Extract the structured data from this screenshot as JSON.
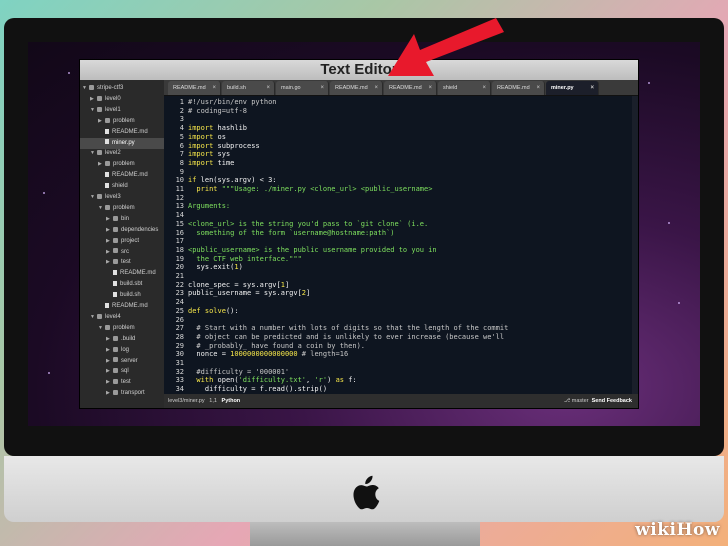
{
  "window_title": "Text Editor",
  "sidebar": [
    {
      "label": "stripe-ctf3",
      "depth": 0,
      "type": "folder",
      "open": true
    },
    {
      "label": "level0",
      "depth": 1,
      "type": "folder",
      "open": false
    },
    {
      "label": "level1",
      "depth": 1,
      "type": "folder",
      "open": true
    },
    {
      "label": "problem",
      "depth": 2,
      "type": "folder",
      "open": false
    },
    {
      "label": "README.md",
      "depth": 2,
      "type": "file"
    },
    {
      "label": "miner.py",
      "depth": 2,
      "type": "file",
      "selected": true
    },
    {
      "label": "level2",
      "depth": 1,
      "type": "folder",
      "open": true
    },
    {
      "label": "problem",
      "depth": 2,
      "type": "folder",
      "open": false
    },
    {
      "label": "README.md",
      "depth": 2,
      "type": "file"
    },
    {
      "label": "shield",
      "depth": 2,
      "type": "file"
    },
    {
      "label": "level3",
      "depth": 1,
      "type": "folder",
      "open": true
    },
    {
      "label": "problem",
      "depth": 2,
      "type": "folder",
      "open": true
    },
    {
      "label": "bin",
      "depth": 3,
      "type": "folder",
      "open": false
    },
    {
      "label": "dependencies",
      "depth": 3,
      "type": "folder",
      "open": false
    },
    {
      "label": "project",
      "depth": 3,
      "type": "folder",
      "open": false
    },
    {
      "label": "src",
      "depth": 3,
      "type": "folder",
      "open": false
    },
    {
      "label": "test",
      "depth": 3,
      "type": "folder",
      "open": false
    },
    {
      "label": "README.md",
      "depth": 3,
      "type": "file"
    },
    {
      "label": "build.sbt",
      "depth": 3,
      "type": "file"
    },
    {
      "label": "build.sh",
      "depth": 3,
      "type": "file"
    },
    {
      "label": "README.md",
      "depth": 2,
      "type": "file"
    },
    {
      "label": "level4",
      "depth": 1,
      "type": "folder",
      "open": true
    },
    {
      "label": "problem",
      "depth": 2,
      "type": "folder",
      "open": true
    },
    {
      "label": ".build",
      "depth": 3,
      "type": "folder",
      "open": false
    },
    {
      "label": "log",
      "depth": 3,
      "type": "folder",
      "open": false
    },
    {
      "label": "server",
      "depth": 3,
      "type": "folder",
      "open": false
    },
    {
      "label": "sql",
      "depth": 3,
      "type": "folder",
      "open": false
    },
    {
      "label": "test",
      "depth": 3,
      "type": "folder",
      "open": false
    },
    {
      "label": "transport",
      "depth": 3,
      "type": "folder",
      "open": false
    }
  ],
  "tabs": [
    {
      "label": "README.md",
      "active": false
    },
    {
      "label": "build.sh",
      "active": false
    },
    {
      "label": "main.go",
      "active": false
    },
    {
      "label": "README.md",
      "active": false
    },
    {
      "label": "README.md",
      "active": false
    },
    {
      "label": "shield",
      "active": false
    },
    {
      "label": "README.md",
      "active": false
    },
    {
      "label": "miner.py",
      "active": true
    }
  ],
  "code": [
    {
      "n": "1",
      "s": [
        [
          "#!/usr/bin/env python",
          "comment"
        ]
      ]
    },
    {
      "n": "2",
      "s": [
        [
          "# coding=utf-8",
          "comment"
        ]
      ]
    },
    {
      "n": "3",
      "s": []
    },
    {
      "n": "4",
      "s": [
        [
          "import",
          "keyword"
        ],
        [
          " hashlib",
          "normal"
        ]
      ]
    },
    {
      "n": "5",
      "s": [
        [
          "import",
          "keyword"
        ],
        [
          " os",
          "normal"
        ]
      ]
    },
    {
      "n": "6",
      "s": [
        [
          "import",
          "keyword"
        ],
        [
          " subprocess",
          "normal"
        ]
      ]
    },
    {
      "n": "7",
      "s": [
        [
          "import",
          "keyword"
        ],
        [
          " sys",
          "normal"
        ]
      ]
    },
    {
      "n": "8",
      "s": [
        [
          "import",
          "keyword"
        ],
        [
          " time",
          "normal"
        ]
      ]
    },
    {
      "n": "9",
      "s": []
    },
    {
      "n": "10",
      "s": [
        [
          "if",
          "keyword"
        ],
        [
          " len(sys.argv) < 3:",
          "normal"
        ]
      ]
    },
    {
      "n": "11",
      "s": [
        [
          "  print ",
          "keyword"
        ],
        [
          "\"\"\"Usage: ./miner.py <clone_url> <public_username>",
          "string"
        ]
      ]
    },
    {
      "n": "12",
      "s": []
    },
    {
      "n": "13",
      "s": [
        [
          "Arguments:",
          "string"
        ]
      ]
    },
    {
      "n": "14",
      "s": []
    },
    {
      "n": "15",
      "s": [
        [
          "<clone_url> is the string you'd pass to `git clone` (i.e.",
          "string"
        ]
      ]
    },
    {
      "n": "16",
      "s": [
        [
          "  something of the form `username@hostname:path`)",
          "string"
        ]
      ]
    },
    {
      "n": "17",
      "s": []
    },
    {
      "n": "18",
      "s": [
        [
          "<public_username> is the public username provided to you in",
          "string"
        ]
      ]
    },
    {
      "n": "19",
      "s": [
        [
          "  the CTF web interface.\"\"\"",
          "string"
        ]
      ]
    },
    {
      "n": "20",
      "s": [
        [
          "  sys.exit(",
          "normal"
        ],
        [
          "1",
          "keyword"
        ],
        [
          ")",
          "normal"
        ]
      ]
    },
    {
      "n": "21",
      "s": []
    },
    {
      "n": "22",
      "s": [
        [
          "clone_spec = sys.argv[",
          "normal"
        ],
        [
          "1",
          "keyword"
        ],
        [
          "]",
          "normal"
        ]
      ]
    },
    {
      "n": "23",
      "s": [
        [
          "public_username = sys.argv[",
          "normal"
        ],
        [
          "2",
          "keyword"
        ],
        [
          "]",
          "normal"
        ]
      ]
    },
    {
      "n": "24",
      "s": []
    },
    {
      "n": "25",
      "s": [
        [
          "def",
          "keyword"
        ],
        [
          " solve",
          "keyword"
        ],
        [
          "():",
          "normal"
        ]
      ]
    },
    {
      "n": "26",
      "s": []
    },
    {
      "n": "27",
      "s": [
        [
          "  # Start with a number with lots of digits so that the length of the commit",
          "comment"
        ]
      ]
    },
    {
      "n": "28",
      "s": [
        [
          "  # object can be predicted and is unlikely to ever increase (because we'll",
          "comment"
        ]
      ]
    },
    {
      "n": "29",
      "s": [
        [
          "  # _probably_ have found a coin by then).",
          "comment"
        ]
      ]
    },
    {
      "n": "30",
      "s": [
        [
          "  nonce = ",
          "normal"
        ],
        [
          "1000000000000000",
          "keyword"
        ],
        [
          " # length=16",
          "comment"
        ]
      ]
    },
    {
      "n": "31",
      "s": []
    },
    {
      "n": "32",
      "s": [
        [
          "  #difficulty = '000001'",
          "comment"
        ]
      ]
    },
    {
      "n": "33",
      "s": [
        [
          "  with",
          "keyword"
        ],
        [
          " open(",
          "normal"
        ],
        [
          "'difficulty.txt'",
          "string"
        ],
        [
          ", ",
          "normal"
        ],
        [
          "'r'",
          "string"
        ],
        [
          ") ",
          "normal"
        ],
        [
          "as",
          "keyword"
        ],
        [
          " f:",
          "normal"
        ]
      ]
    },
    {
      "n": "34",
      "s": [
        [
          "    difficulty = f.read().strip()",
          "normal"
        ]
      ]
    },
    {
      "n": "35",
      "s": []
    }
  ],
  "status": {
    "path": "level3/miner.py",
    "position": "1,1",
    "language": "Python",
    "branch": "master",
    "feedback": "Send Feedback"
  },
  "branding": {
    "wiki": "wiki",
    "how": "How"
  },
  "colors": {
    "arrow": "#e8192c",
    "keyword": "#f7e74a",
    "string": "#7ee05e",
    "comment": "#c8c8c8"
  }
}
